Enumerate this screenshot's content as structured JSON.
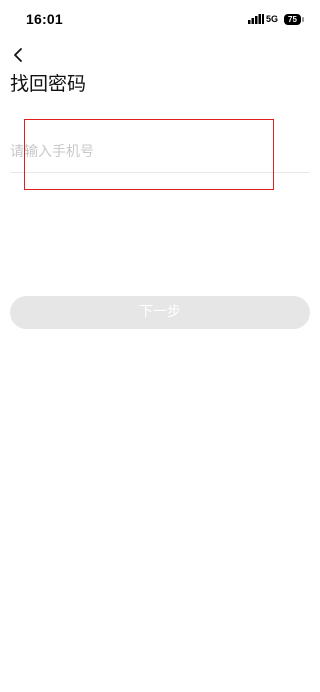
{
  "status_bar": {
    "time": "16:01",
    "network": "5G",
    "battery": "75"
  },
  "header": {
    "back_icon": "chevron-left-icon",
    "title": "找回密码"
  },
  "form": {
    "phone_placeholder": "请输入手机号",
    "phone_value": ""
  },
  "actions": {
    "next_label": "下一步"
  },
  "colors": {
    "highlight": "#e02020",
    "button_disabled": "#e6e6e6",
    "placeholder": "#c8c8c8"
  }
}
